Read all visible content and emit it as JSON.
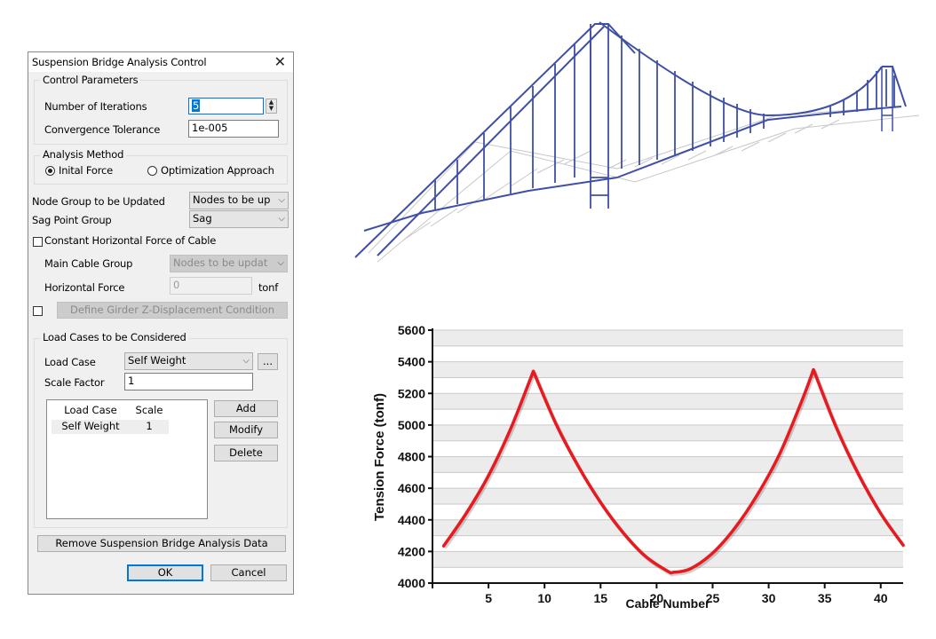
{
  "dialog": {
    "title": "Suspension Bridge Analysis Control",
    "close_icon": "close-x-icon",
    "control_parameters": {
      "group_title": "Control Parameters",
      "iterations_label": "Number of Iterations",
      "iterations_value": "5",
      "tolerance_label": "Convergence Tolerance",
      "tolerance_value": "1e-005"
    },
    "analysis_method": {
      "group_title": "Analysis Method",
      "options": [
        "Inital Force",
        "Optimization Approach"
      ],
      "selected": "Inital Force"
    },
    "node_group_label": "Node Group to be Updated",
    "node_group_value": "Nodes to be up",
    "sag_group_label": "Sag Point Group",
    "sag_group_value": "Sag",
    "constant_force_label": "Constant Horizontal Force of Cable",
    "constant_force_checked": false,
    "main_cable_label": "Main Cable Group",
    "main_cable_value": "Nodes to be updat",
    "horizontal_force_label": "Horizontal Force",
    "horizontal_force_value": "0",
    "horizontal_force_unit": "tonf",
    "girder_condition_checked": false,
    "girder_condition_button": "Define Girder Z-Displacement Condition",
    "load_cases": {
      "group_title": "Load Cases to be Considered",
      "load_case_label": "Load Case",
      "load_case_value": "Self Weight",
      "more_button": "...",
      "scale_label": "Scale Factor",
      "scale_value": "1",
      "list_headers": [
        "Load Case",
        "Scale"
      ],
      "list_rows": [
        {
          "load_case": "Self Weight",
          "scale": "1"
        }
      ],
      "add_button": "Add",
      "modify_button": "Modify",
      "delete_button": "Delete"
    },
    "remove_button": "Remove Suspension Bridge Analysis Data",
    "ok_button": "OK",
    "cancel_button": "Cancel"
  },
  "bridge_view": {
    "description": "3D wireframe of suspension bridge model",
    "cable_color": "#3f4fa8",
    "deck_color": "#c8c8c8"
  },
  "chart_data": {
    "type": "line",
    "title": "",
    "xlabel": "Cable Number",
    "ylabel": "Tension Force (tonf)",
    "xlim": [
      0,
      42
    ],
    "ylim": [
      4000,
      5600
    ],
    "xticks": [
      5,
      10,
      15,
      20,
      25,
      30,
      35,
      40
    ],
    "yticks": [
      4000,
      4200,
      4400,
      4600,
      4800,
      5000,
      5200,
      5400,
      5600
    ],
    "grid": "horizontal-banded",
    "line_color": "#e8191f",
    "series": [
      {
        "name": "Tension Force",
        "x": [
          1,
          3,
          5,
          7,
          9,
          11,
          13,
          15,
          17,
          19,
          21,
          21.5,
          23,
          25,
          27,
          29,
          31,
          33,
          34,
          36,
          38,
          40,
          42
        ],
        "values": [
          4235,
          4440,
          4680,
          4980,
          5340,
          5010,
          4740,
          4510,
          4320,
          4170,
          4075,
          4068,
          4090,
          4190,
          4350,
          4560,
          4820,
          5160,
          5350,
          4990,
          4690,
          4440,
          4240
        ]
      }
    ]
  }
}
